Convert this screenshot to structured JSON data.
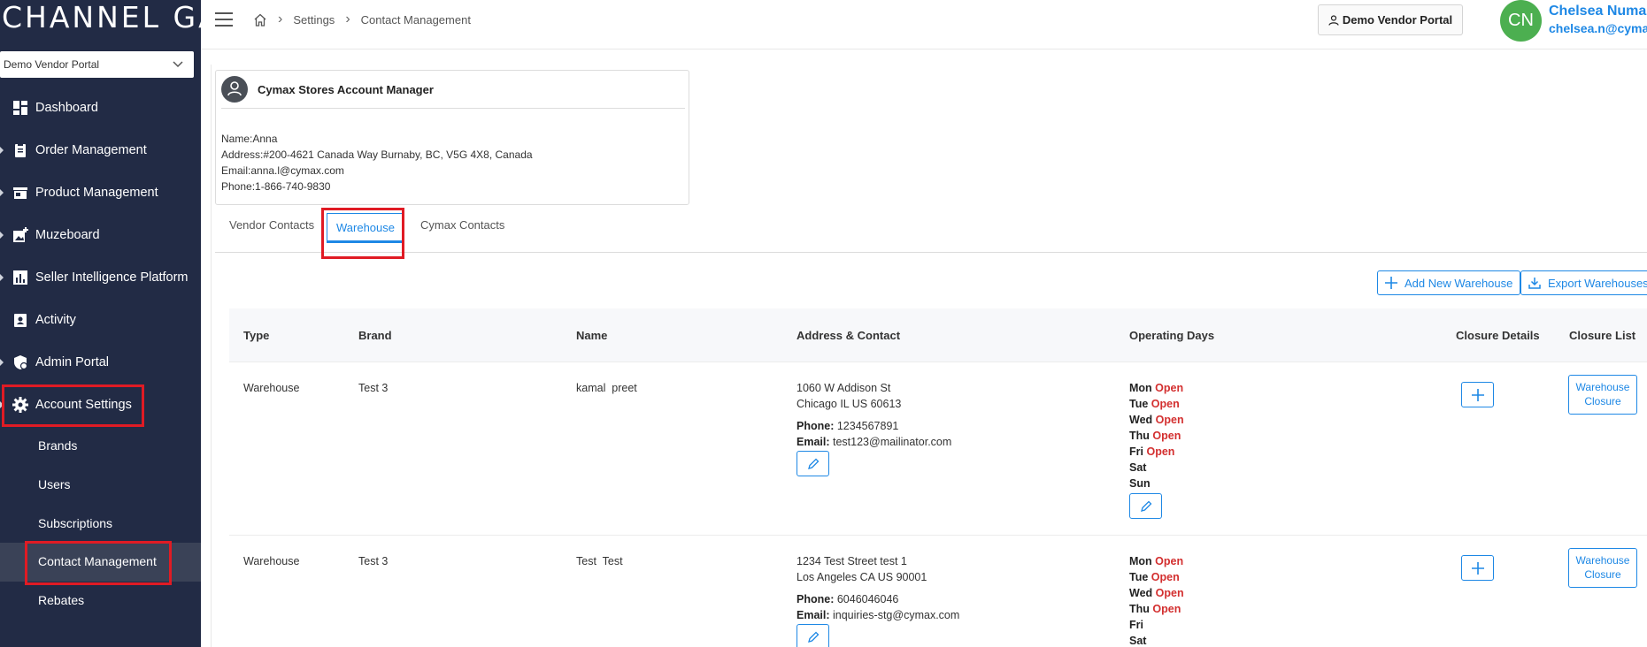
{
  "app": {
    "logo": "CHANNEL GATE"
  },
  "sidebar": {
    "portal_select": "Demo Vendor Portal",
    "items": [
      {
        "label": "Dashboard",
        "icon": "dashboard-icon"
      },
      {
        "label": "Order Management",
        "icon": "clipboard-icon"
      },
      {
        "label": "Product Management",
        "icon": "store-icon"
      },
      {
        "label": "Muzeboard",
        "icon": "add-photo-icon"
      },
      {
        "label": "Seller Intelligence Platform",
        "icon": "bar-chart-icon"
      },
      {
        "label": "Activity",
        "icon": "badge-icon"
      },
      {
        "label": "Admin Portal",
        "icon": "admin-shield-icon"
      },
      {
        "label": "Account Settings",
        "icon": "gear-icon"
      }
    ],
    "sub_items": [
      {
        "label": "Brands"
      },
      {
        "label": "Users"
      },
      {
        "label": "Subscriptions"
      },
      {
        "label": "Contact Management"
      },
      {
        "label": "Rebates"
      }
    ]
  },
  "header": {
    "breadcrumb": {
      "home_icon": "home-icon",
      "settings": "Settings",
      "current": "Contact Management"
    },
    "vendor_button": "Demo Vendor Portal",
    "user": {
      "initials": "CN",
      "name": "Chelsea Numan",
      "email": "chelsea.n@cymax"
    }
  },
  "manager": {
    "title": "Cymax Stores Account Manager",
    "name": "Name:Anna",
    "address": "Address:#200-4621 Canada Way Burnaby, BC, V5G 4X8, Canada",
    "email": "Email:anna.l@cymax.com",
    "phone": "Phone:1-866-740-9830"
  },
  "tabs": {
    "vendor_contacts": "Vendor Contacts",
    "warehouse": "Warehouse",
    "cymax_contacts": "Cymax Contacts"
  },
  "actions": {
    "add": "Add New Warehouse",
    "export": "Export Warehouses"
  },
  "table": {
    "headers": {
      "type": "Type",
      "brand": "Brand",
      "name": "Name",
      "address": "Address & Contact",
      "days": "Operating Days",
      "closure_details": "Closure Details",
      "closure_list": "Closure List"
    },
    "phone_label": "Phone:",
    "email_label": "Email:",
    "closure_btn_1": "Warehouse",
    "closure_btn_2": "Closure",
    "rows": [
      {
        "type": "Warehouse",
        "brand": "Test 3",
        "name": "kamal  preet",
        "addr1": "1060 W Addison St",
        "addr2": "Chicago IL US 60613",
        "phone": "1234567891",
        "email": "test123@mailinator.com",
        "days": [
          {
            "d": "Mon",
            "s": "Open"
          },
          {
            "d": "Tue",
            "s": "Open"
          },
          {
            "d": "Wed",
            "s": "Open"
          },
          {
            "d": "Thu",
            "s": "Open"
          },
          {
            "d": "Fri",
            "s": "Open"
          },
          {
            "d": "Sat",
            "s": ""
          },
          {
            "d": "Sun",
            "s": ""
          }
        ]
      },
      {
        "type": "Warehouse",
        "brand": "Test 3",
        "name": "Test  Test",
        "addr1": "1234 Test Street test 1",
        "addr2": "Los Angeles CA US 90001",
        "phone": "6046046046",
        "email": "inquiries-stg@cymax.com",
        "days": [
          {
            "d": "Mon",
            "s": "Open"
          },
          {
            "d": "Tue",
            "s": "Open"
          },
          {
            "d": "Wed",
            "s": "Open"
          },
          {
            "d": "Thu",
            "s": "Open"
          },
          {
            "d": "Fri",
            "s": ""
          },
          {
            "d": "Sat",
            "s": ""
          }
        ]
      }
    ]
  },
  "colors": {
    "sidebar": "#222b45",
    "accent": "#1e88e5",
    "open": "#d32f2f",
    "highlight": "#e01b24",
    "avatar": "#4caf50"
  }
}
